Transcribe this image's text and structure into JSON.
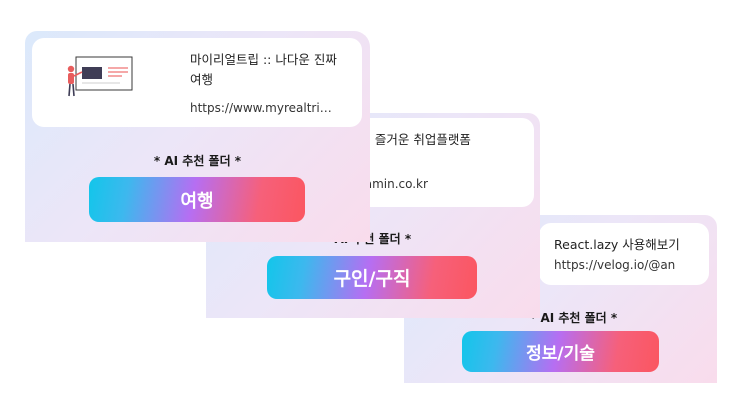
{
  "cards": [
    {
      "link_title": "마이리얼트립 :: 나다운 진짜 여행",
      "link_url": "https://www.myrealtrip.com",
      "folder_label": "* AI 추천 폴더 *",
      "folder_name": "여행"
    },
    {
      "link_title": "사람인 - 내일이 더 즐거운 취업플랫폼",
      "link_url": "https://www.saramin.co.kr",
      "folder_label": "* AI 추천 폴더 *",
      "folder_name": "구인/구직"
    },
    {
      "link_title": "React.lazy 사용해보기",
      "link_url": "https://velog.io/@an",
      "folder_label": "* AI 추천 폴더 *",
      "folder_name": "정보/기술"
    }
  ],
  "colors": {
    "button_gradient_start": "#12c6ea",
    "button_gradient_mid": "#b66ef2",
    "button_gradient_end": "#fb5660",
    "card_gradient_start": "#dbe9fb",
    "card_gradient_end": "#f9dcec"
  },
  "icons": [
    "presentation-illustration"
  ]
}
